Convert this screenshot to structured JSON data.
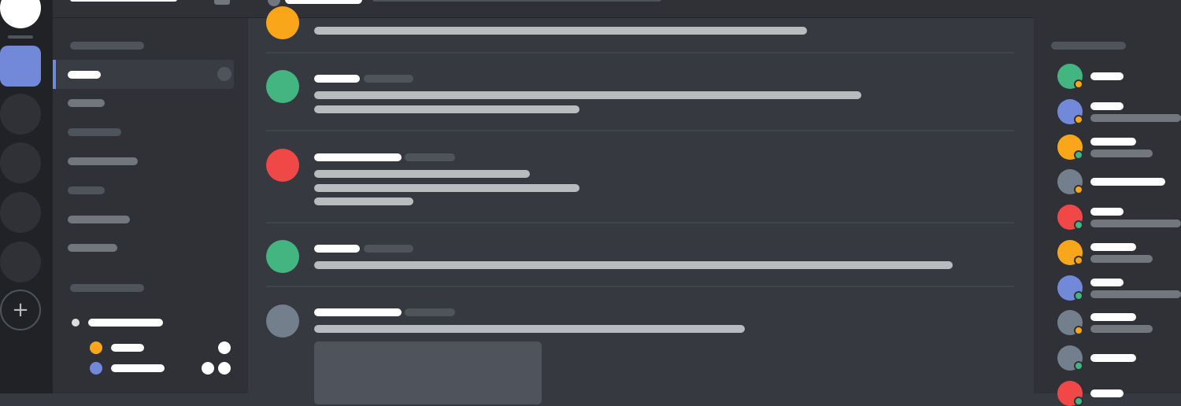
{
  "colors": {
    "blurple": "#7289da",
    "green": "#43b581",
    "red": "#f04747",
    "orange": "#faa61a",
    "gray": "#747f8d"
  },
  "guild_rail": {
    "add_icon": "plus-icon",
    "add_glyph": "+"
  },
  "messages": [
    {
      "avatar_color": "#faa61a"
    },
    {
      "avatar_color": "#43b581"
    },
    {
      "avatar_color": "#f04747"
    },
    {
      "avatar_color": "#43b581"
    },
    {
      "avatar_color": "#747f8d"
    }
  ],
  "members": [
    {
      "avatar_color": "#43b581",
      "status": "idle"
    },
    {
      "avatar_color": "#7289da",
      "status": "idle"
    },
    {
      "avatar_color": "#faa61a",
      "status": "online"
    },
    {
      "avatar_color": "#747f8d",
      "status": "idle"
    },
    {
      "avatar_color": "#f04747",
      "status": "online"
    },
    {
      "avatar_color": "#faa61a",
      "status": "idle"
    },
    {
      "avatar_color": "#7289da",
      "status": "online"
    },
    {
      "avatar_color": "#747f8d",
      "status": "idle"
    },
    {
      "avatar_color": "#747f8d",
      "status": "online"
    },
    {
      "avatar_color": "#f04747",
      "status": "online"
    }
  ]
}
